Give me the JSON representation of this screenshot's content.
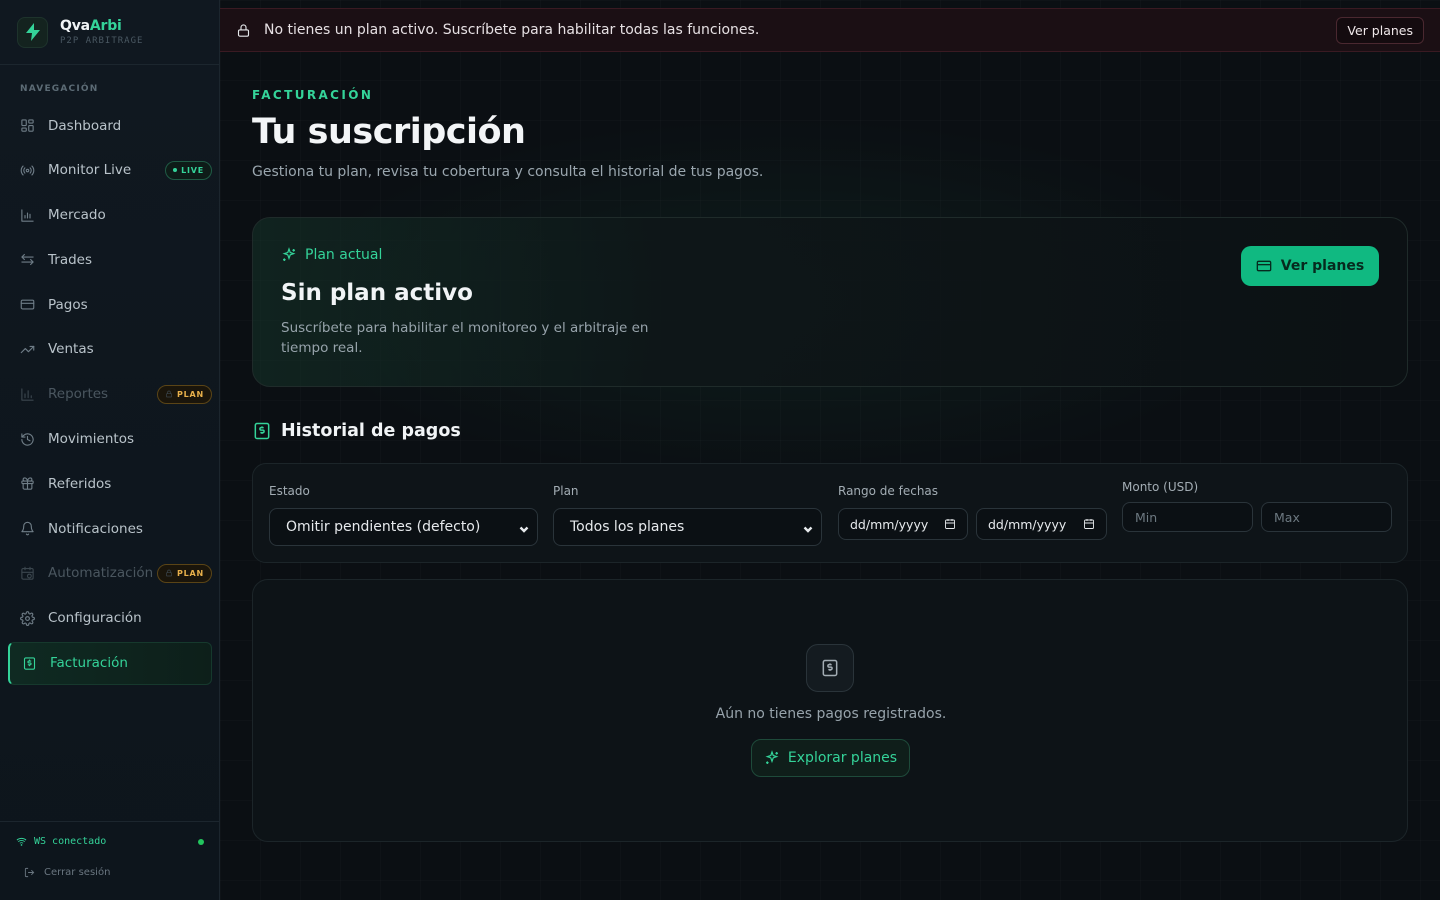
{
  "brand": {
    "name_part1": "Qva",
    "name_part2": "Arbi",
    "subtitle": "P2P ARBITRAGE"
  },
  "nav": {
    "heading": "NAVEGACIÓN",
    "items": [
      {
        "label": "Dashboard",
        "icon": "grid-icon"
      },
      {
        "label": "Monitor Live",
        "icon": "radio-icon",
        "badge": "LIVE"
      },
      {
        "label": "Mercado",
        "icon": "chart-icon"
      },
      {
        "label": "Trades",
        "icon": "arrows-icon"
      },
      {
        "label": "Pagos",
        "icon": "card-icon"
      },
      {
        "label": "Ventas",
        "icon": "trend-icon"
      },
      {
        "label": "Reportes",
        "icon": "bar-chart-icon",
        "badge": "PLAN",
        "locked": true
      },
      {
        "label": "Movimientos",
        "icon": "history-icon"
      },
      {
        "label": "Referidos",
        "icon": "gift-icon"
      },
      {
        "label": "Notificaciones",
        "icon": "bell-icon"
      },
      {
        "label": "Automatización",
        "icon": "calendar-icon",
        "badge": "PLAN",
        "locked": true
      },
      {
        "label": "Configuración",
        "icon": "gear-icon"
      },
      {
        "label": "Facturación",
        "icon": "receipt-icon",
        "active": true
      }
    ]
  },
  "footer": {
    "ws_status": "WS conectado",
    "logout": "Cerrar sesión"
  },
  "alert": {
    "text": "No tienes un plan activo. Suscríbete para habilitar todas las funciones.",
    "button": "Ver planes"
  },
  "header": {
    "eyebrow": "FACTURACIÓN",
    "title": "Tu suscripción",
    "subtitle": "Gestiona tu plan, revisa tu cobertura y consulta el historial de tus pagos."
  },
  "plan_card": {
    "eyebrow": "Plan actual",
    "title": "Sin plan activo",
    "description": "Suscríbete para habilitar el monitoreo y el arbitraje en tiempo real.",
    "button": "Ver planes"
  },
  "history": {
    "title": "Historial de pagos",
    "filters": {
      "estado_label": "Estado",
      "estado_value": "Omitir pendientes (defecto)",
      "plan_label": "Plan",
      "plan_value": "Todos los planes",
      "fechas_label": "Rango de fechas",
      "date_from_placeholder": "dd/mm/yyyy",
      "date_to_placeholder": "dd/mm/yyyy",
      "monto_label": "Monto (USD)",
      "min_placeholder": "Min",
      "max_placeholder": "Max"
    },
    "empty_text": "Aún no tienes pagos registrados.",
    "empty_button": "Explorar planes"
  },
  "colors": {
    "accent": "#34d399",
    "primary_button": "#10b981",
    "plan_badge": "#e8b04b",
    "alert_bg": "#1b0f14"
  }
}
